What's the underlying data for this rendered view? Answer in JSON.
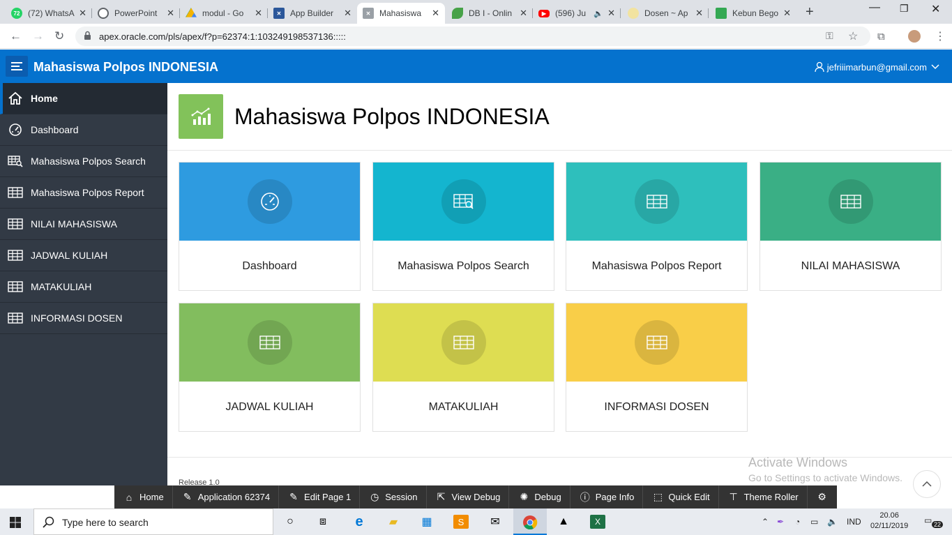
{
  "browser": {
    "tabs": [
      {
        "label": "(72) WhatsA",
        "color": "#25d366",
        "badge": "72"
      },
      {
        "label": "PowerPoint",
        "color": "#5f6368",
        "badge": ""
      },
      {
        "label": "modul - Go",
        "color": "#f4b400",
        "badge": ""
      },
      {
        "label": "App Builder",
        "color": "#2b579a",
        "badge": ""
      },
      {
        "label": "Mahasiswa",
        "color": "#9aa0a6",
        "badge": ""
      },
      {
        "label": "DB I - Onlin",
        "color": "#47a248",
        "badge": ""
      },
      {
        "label": "(596) Ju",
        "color": "#ff0000",
        "badge": ""
      },
      {
        "label": "Dosen ~ Ap",
        "color": "#f2e3a0",
        "badge": ""
      },
      {
        "label": "Kebun Bego",
        "color": "#34a853",
        "badge": ""
      }
    ],
    "url": "apex.oracle.com/pls/apex/f?p=62374:1:103249198537136:::::"
  },
  "header": {
    "app_title": "Mahasiswa Polpos INDONESIA",
    "user_email": "jefriiimarbun@gmail.com"
  },
  "sidebar": {
    "items": [
      {
        "label": "Home",
        "icon": "home-icon"
      },
      {
        "label": "Dashboard",
        "icon": "dashboard-icon"
      },
      {
        "label": "Mahasiswa Polpos Search",
        "icon": "table-search-icon"
      },
      {
        "label": "Mahasiswa Polpos Report",
        "icon": "table-icon"
      },
      {
        "label": "NILAI MAHASISWA",
        "icon": "table-icon"
      },
      {
        "label": "JADWAL KULIAH",
        "icon": "table-icon"
      },
      {
        "label": "MATAKULIAH",
        "icon": "table-icon"
      },
      {
        "label": "INFORMASI DOSEN",
        "icon": "table-icon"
      }
    ]
  },
  "page": {
    "title": "Mahasiswa Polpos INDONESIA",
    "cards": [
      {
        "label": "Dashboard",
        "color": "#2e9be0",
        "icon": "dashboard-icon"
      },
      {
        "label": "Mahasiswa Polpos Search",
        "color": "#14b5cf",
        "icon": "table-search-icon"
      },
      {
        "label": "Mahasiswa Polpos Report",
        "color": "#2ebfbc",
        "icon": "table-icon"
      },
      {
        "label": "NILAI MAHASISWA",
        "color": "#3aaf85",
        "icon": "table-icon"
      },
      {
        "label": "JADWAL KULIAH",
        "color": "#82bd5e",
        "icon": "table-icon"
      },
      {
        "label": "MATAKULIAH",
        "color": "#dedd52",
        "icon": "table-icon"
      },
      {
        "label": "INFORMASI DOSEN",
        "color": "#f9ce48",
        "icon": "table-icon"
      }
    ],
    "release": "Release 1.0"
  },
  "watermark": {
    "line1": "Activate Windows",
    "line2": "Go to Settings to activate Windows."
  },
  "dev_toolbar": [
    {
      "label": "Home",
      "icon": "home-icon"
    },
    {
      "label": "Application 62374",
      "icon": "edit-icon"
    },
    {
      "label": "Edit Page 1",
      "icon": "edit-icon"
    },
    {
      "label": "Session",
      "icon": "clock-icon"
    },
    {
      "label": "View Debug",
      "icon": "view-debug-icon"
    },
    {
      "label": "Debug",
      "icon": "bug-icon"
    },
    {
      "label": "Page Info",
      "icon": "info-icon"
    },
    {
      "label": "Quick Edit",
      "icon": "quick-edit-icon"
    },
    {
      "label": "Theme Roller",
      "icon": "paint-roller-icon"
    },
    {
      "label": "",
      "icon": "gear-icon"
    }
  ],
  "taskbar": {
    "search_placeholder": "Type here to search",
    "language": "IND",
    "time": "20.06",
    "date": "02/11/2019",
    "notifications": "22"
  }
}
